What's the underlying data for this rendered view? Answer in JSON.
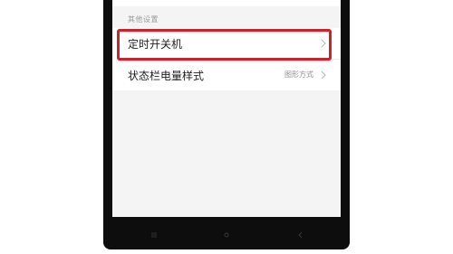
{
  "section": {
    "header": "其他设置"
  },
  "rows": [
    {
      "label": "定时开关机",
      "value": ""
    },
    {
      "label": "状态栏电量样式",
      "value": "图形方式"
    }
  ],
  "colors": {
    "highlight": "#d0202a",
    "phone_frame": "#0d0d0d",
    "screen_bg": "#f4f4f4"
  },
  "icons": {
    "chevron": "chevron-right-icon",
    "nav_menu": "menu-icon",
    "nav_home": "home-icon",
    "nav_back": "back-icon"
  }
}
